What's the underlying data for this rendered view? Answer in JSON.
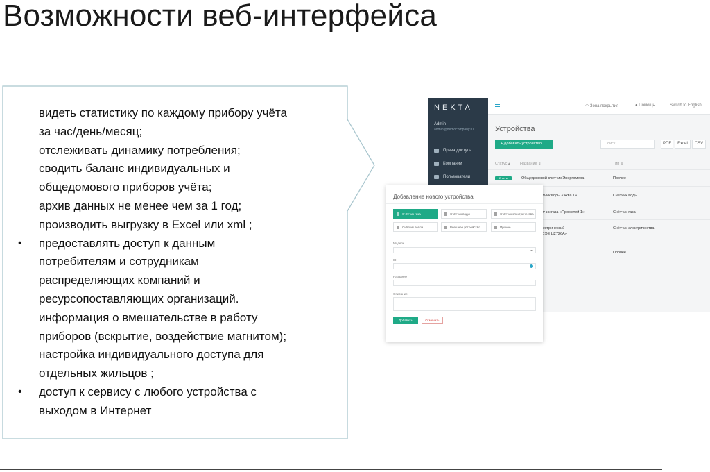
{
  "slide": {
    "title": "Возможности  веб-интерфейса"
  },
  "features": [
    {
      "text": "видеть статистику по каждому прибору учёта",
      "bullet": false
    },
    {
      "text": "за час/день/месяц;",
      "bullet": false
    },
    {
      "text": "отслеживать динамику потребления;",
      "bullet": false
    },
    {
      "text": "сводить баланс индивидуальных и",
      "bullet": false
    },
    {
      "text": "общедомового приборов учёта;",
      "bullet": false
    },
    {
      "text": "архив данных не менее чем за 1 год;",
      "bullet": false
    },
    {
      "text": "производить выгрузку в   Excel или xml ;",
      "bullet": false
    },
    {
      "text": "предоставлять доступ к данным",
      "bullet": true
    },
    {
      "text": "потребителям и сотрудникам",
      "bullet": false
    },
    {
      "text": "распределяющих компаний и",
      "bullet": false
    },
    {
      "text": "ресурсопоставляющих  организаций.",
      "bullet": false
    },
    {
      "text": "информация о вмешательстве в работу",
      "bullet": false
    },
    {
      "text": "приборов (вскрытие, воздействие магнитом);",
      "bullet": false
    },
    {
      "text": "настройка индивидуального доступа для",
      "bullet": false
    },
    {
      "text": "отдельных жильцов ;",
      "bullet": false
    },
    {
      "text": "доступ к сервису с любого  устройства  с",
      "bullet": true
    },
    {
      "text": "выходом  в Интернет",
      "bullet": false
    }
  ],
  "app": {
    "logo": "NEKTA",
    "user_name": "Admin",
    "user_email": "admin@democompany.ru",
    "sidebar": [
      "Права доступа",
      "Компании",
      "Пользователи"
    ],
    "topbar": {
      "coverage": "Зона покрытия",
      "help": "Помощь",
      "language": "Switch to English"
    },
    "heading": "Устройства",
    "add_button": "Добавить устройство",
    "search_placeholder": "Поиск",
    "export": [
      "PDF",
      "Excel",
      "CSV"
    ],
    "columns": {
      "status": "Статус",
      "name": "Название",
      "type": "Тип"
    },
    "rows": [
      {
        "badge": "В сети",
        "name": "Общедомовой счетчик Энергомера",
        "type": "Прочее"
      },
      {
        "name": "счётчик воды «Аква 1»",
        "type": "Счётчик воды"
      },
      {
        "name": "счётчик газа «Прометей 1»",
        "type": "Счётчик газа"
      },
      {
        "name": "электрический",
        "name2": "й «СЭЕ Ц2726А»",
        "type": "Счётчик электричества"
      },
      {
        "name": "»",
        "type": "Прочее"
      }
    ]
  },
  "modal": {
    "title": "Добавление нового устройства",
    "types": [
      "Счётчик газа",
      "Счётчик воды",
      "Счётчик электричества",
      "Счётчик тепла",
      "Внешнее устройство",
      "Прочее"
    ],
    "fields": {
      "model": "Модель",
      "id": "ID",
      "name": "Название",
      "description": "Описание"
    },
    "ok_button": "Добавить",
    "cancel_button": "Отменить"
  },
  "colors": {
    "accent": "#1faa87",
    "sidebar": "#2b3a48",
    "link": "#2aa6c8"
  }
}
